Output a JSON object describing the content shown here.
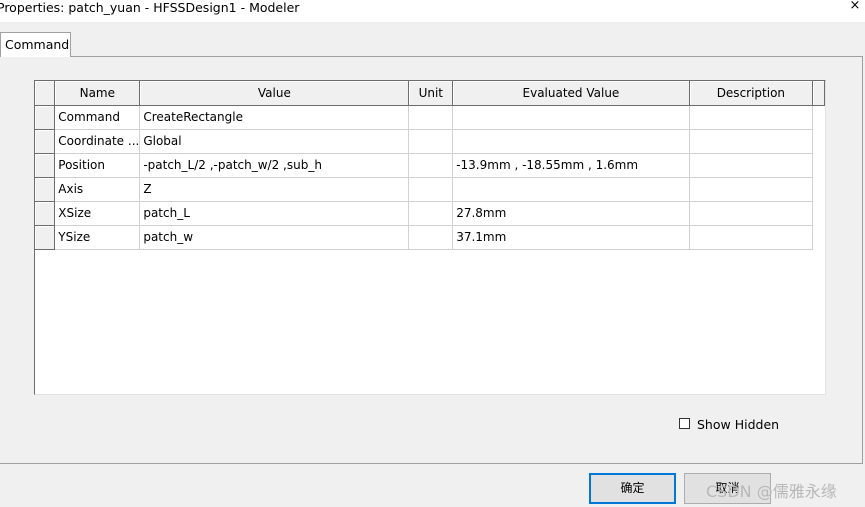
{
  "window": {
    "title": "Properties: patch_yuan - HFSSDesign1 - Modeler",
    "close_glyph": "×"
  },
  "tabs": [
    {
      "label": "Command"
    }
  ],
  "table": {
    "headers": [
      "Name",
      "Value",
      "Unit",
      "Evaluated Value",
      "Description"
    ],
    "rows": [
      {
        "name": "Command",
        "value": "CreateRectangle",
        "unit": "",
        "evaluated": "",
        "description": ""
      },
      {
        "name": "Coordinate ...",
        "value": "Global",
        "unit": "",
        "evaluated": "",
        "description": ""
      },
      {
        "name": "Position",
        "value": "-patch_L/2 ,-patch_w/2 ,sub_h",
        "unit": "",
        "evaluated": "-13.9mm , -18.55mm , 1.6mm",
        "description": ""
      },
      {
        "name": "Axis",
        "value": "Z",
        "unit": "",
        "evaluated": "",
        "description": ""
      },
      {
        "name": "XSize",
        "value": "patch_L",
        "unit": "",
        "evaluated": "27.8mm",
        "description": ""
      },
      {
        "name": "YSize",
        "value": "patch_w",
        "unit": "",
        "evaluated": "37.1mm",
        "description": ""
      }
    ]
  },
  "show_hidden": {
    "label": "Show Hidden",
    "checked": false
  },
  "buttons": {
    "ok": "确定",
    "cancel": "取消"
  },
  "watermark": "CSDN @儒雅永缘"
}
